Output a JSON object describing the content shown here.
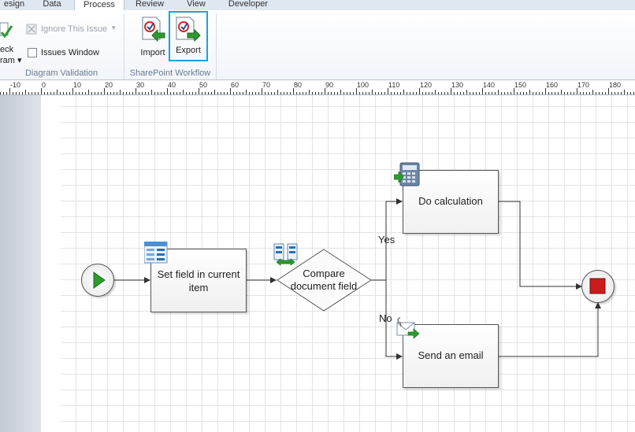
{
  "ribbon": {
    "tabs": [
      {
        "label": "esign",
        "active": false
      },
      {
        "label": "Data",
        "active": false
      },
      {
        "label": "Process",
        "active": true
      },
      {
        "label": "Review",
        "active": false
      },
      {
        "label": "View",
        "active": false
      },
      {
        "label": "Developer",
        "active": false
      }
    ],
    "diagram_validation": {
      "check_label_line1": "eck",
      "check_label_line2": "ram ▾",
      "ignore_issue_label": "Ignore This Issue",
      "issues_window_label": "Issues Window",
      "group_label": "Diagram Validation"
    },
    "sharepoint_workflow": {
      "import_label": "Import",
      "export_label": "Export",
      "group_label": "SharePoint Workflow"
    }
  },
  "ruler": {
    "labels": [
      "-10",
      "0",
      "10",
      "20",
      "30",
      "40",
      "50",
      "60",
      "70",
      "80",
      "90",
      "100",
      "110",
      "120",
      "130",
      "140",
      "150",
      "160",
      "170",
      "180"
    ]
  },
  "diagram": {
    "set_field": "Set field in current item",
    "compare": "Compare document field",
    "do_calc": "Do calculation",
    "send_email": "Send an email",
    "yes_label": "Yes",
    "no_label": "No"
  },
  "colors": {
    "start_green": "#2e9b2e",
    "stop_red": "#cc1b1b",
    "export_highlight": "#1fa0d8"
  }
}
